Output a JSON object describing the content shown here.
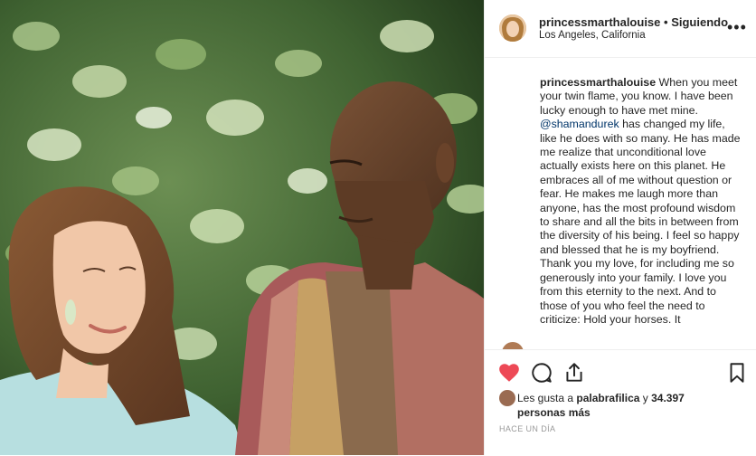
{
  "post": {
    "username": "princessmarthalouise",
    "separator": "•",
    "follow_status": "Siguiendo",
    "location": "Los Angeles, California",
    "more_options": "•••"
  },
  "caption": {
    "username": "princessmarthalouise",
    "text_1": "When you meet your twin flame, you know. I have been lucky enough to have met mine.",
    "mention": "@shamandurek",
    "text_2": "has changed my life, like he does with so many. He has made me realize that unconditional love actually exists here on this planet. He embraces all of me without question or fear. He makes me laugh more than anyone, has the most profound wisdom to share and all the bits in between from the diversity of his being. I feel so happy and blessed that he is my boyfriend. Thank you my love, for including me so generously into your family. I love you from this eternity to the next. And to those of you who feel the need to criticize: Hold your horses. It"
  },
  "actions": {
    "like_icon": "heart-icon-filled",
    "comment_icon": "comment-icon",
    "share_icon": "share-icon",
    "save_icon": "bookmark-icon",
    "like_color": "#ed4956"
  },
  "likes": {
    "prefix": "Les gusta a",
    "user": "palabrafilica",
    "connector": "y",
    "count": "34.397 personas más"
  },
  "timestamp": "HACE UN DÍA"
}
